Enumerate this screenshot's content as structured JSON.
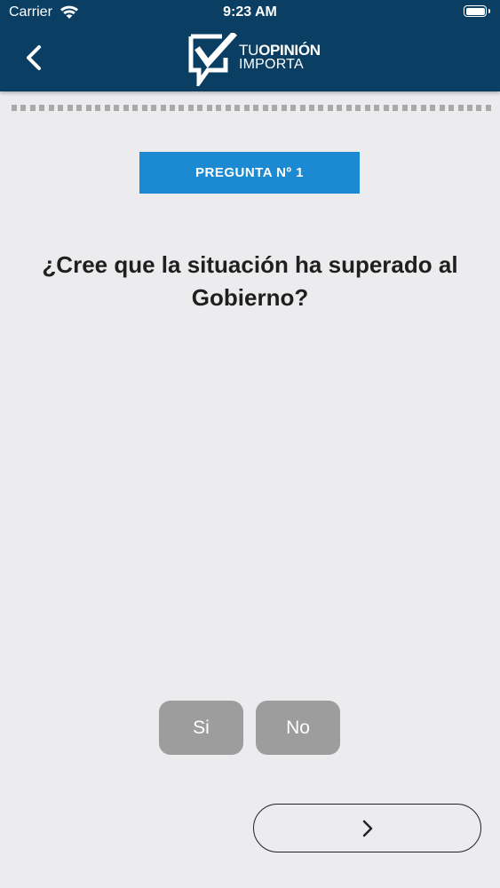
{
  "status_bar": {
    "carrier": "Carrier",
    "time": "9:23 AM",
    "wifi_icon": "wifi-icon",
    "battery_icon": "battery-icon"
  },
  "header": {
    "background_color": "#0a3f63",
    "back_icon": "chevron-left-icon",
    "logo": {
      "line1_part1": "TU",
      "line1_part2": "OPINIÓN",
      "line2": "IMPORTA",
      "mark_icon": "checkbox-check-logo-icon"
    }
  },
  "progress": {
    "indicator": "dotted-progress-line",
    "color": "#a9a9a9"
  },
  "question": {
    "badge_label": "PREGUNTA Nº 1",
    "badge_color": "#1b8ad2",
    "text": "¿Cree que la situación ha superado al Gobierno?"
  },
  "answers": [
    {
      "label": "Si"
    },
    {
      "label": "No"
    }
  ],
  "answer_button_color": "#9d9d9d",
  "next_button": {
    "icon": "chevron-right-icon"
  }
}
